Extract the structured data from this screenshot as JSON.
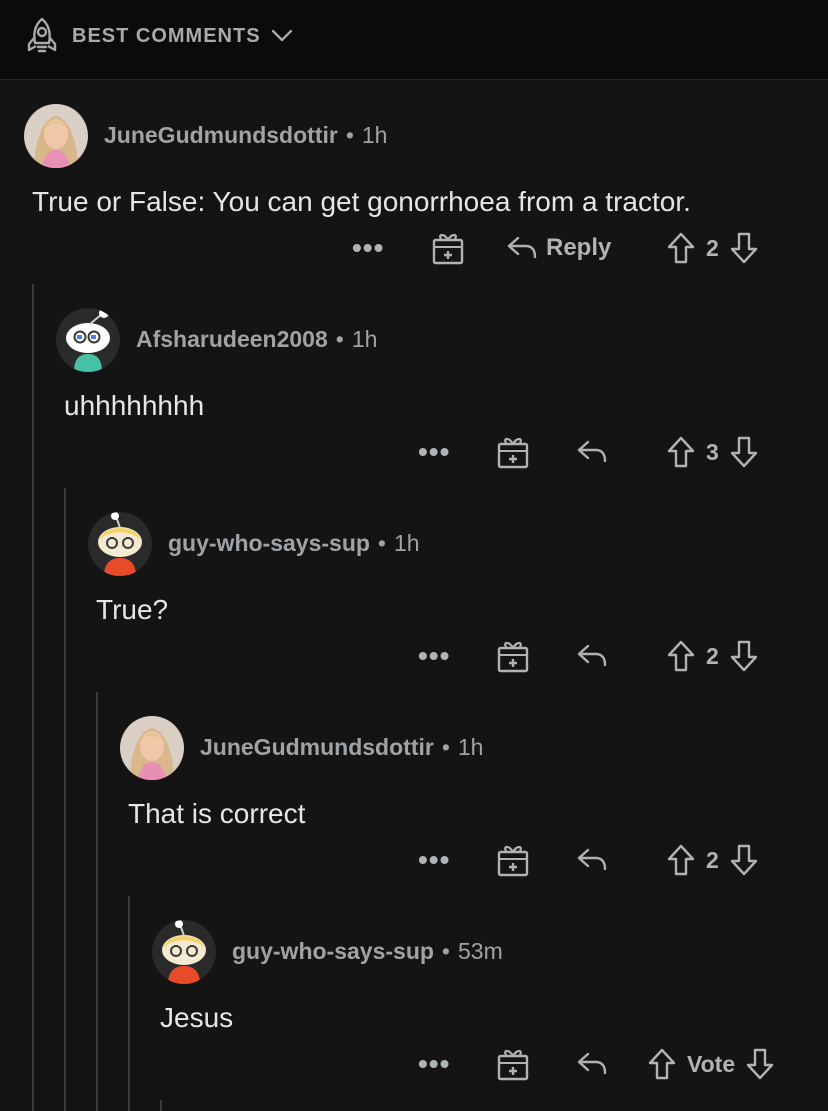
{
  "header": {
    "sort_label": "BEST COMMENTS"
  },
  "comments": [
    {
      "username": "JuneGudmundsdottir",
      "age": "1h",
      "body": "True or False: You can get gonorrhoea from a tractor.",
      "reply_label": "Reply",
      "score": "2",
      "avatar": "photo-avatar"
    },
    {
      "username": "Afsharudeen2008",
      "age": "1h",
      "body": "uhhhhhhhh",
      "reply_label": "",
      "score": "3",
      "avatar": "snoo-avatar"
    },
    {
      "username": "guy-who-says-sup",
      "age": "1h",
      "body": "True?",
      "reply_label": "",
      "score": "2",
      "avatar": "snoo-avatar"
    },
    {
      "username": "JuneGudmundsdottir",
      "age": "1h",
      "body": "That is correct",
      "reply_label": "",
      "score": "2",
      "avatar": "photo-avatar"
    },
    {
      "username": "guy-who-says-sup",
      "age": "53m",
      "body": "Jesus",
      "reply_label": "",
      "score": "Vote",
      "avatar": "snoo-avatar"
    }
  ],
  "icons": [
    "rocket-icon",
    "chevron-down-icon",
    "more-icon",
    "award-icon",
    "reply-icon",
    "upvote-icon",
    "downvote-icon"
  ],
  "colors": {
    "background": "#141414",
    "header": "#0b0b0b",
    "text": "#e4e6e8",
    "meta": "#a0a3a6",
    "thread_line": "#3a3a3a"
  }
}
